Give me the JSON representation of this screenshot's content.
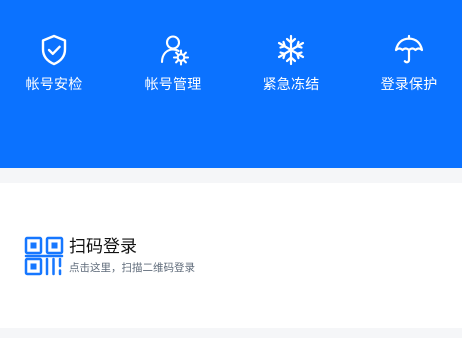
{
  "top_panel": {
    "features": [
      {
        "label": "帐号安检",
        "icon": "shield-check-icon"
      },
      {
        "label": "帐号管理",
        "icon": "user-gear-icon"
      },
      {
        "label": "紧急冻结",
        "icon": "snowflake-icon"
      },
      {
        "label": "登录保护",
        "icon": "umbrella-icon"
      }
    ]
  },
  "scan_login": {
    "title": "扫码登录",
    "subtitle": "点击这里，扫描二维码登录",
    "icon": "qr-code-icon"
  },
  "colors": {
    "primary": "#0b72ff",
    "text_dark": "#111111",
    "text_muted": "#5f6b7a",
    "accent": "#1677ff"
  }
}
